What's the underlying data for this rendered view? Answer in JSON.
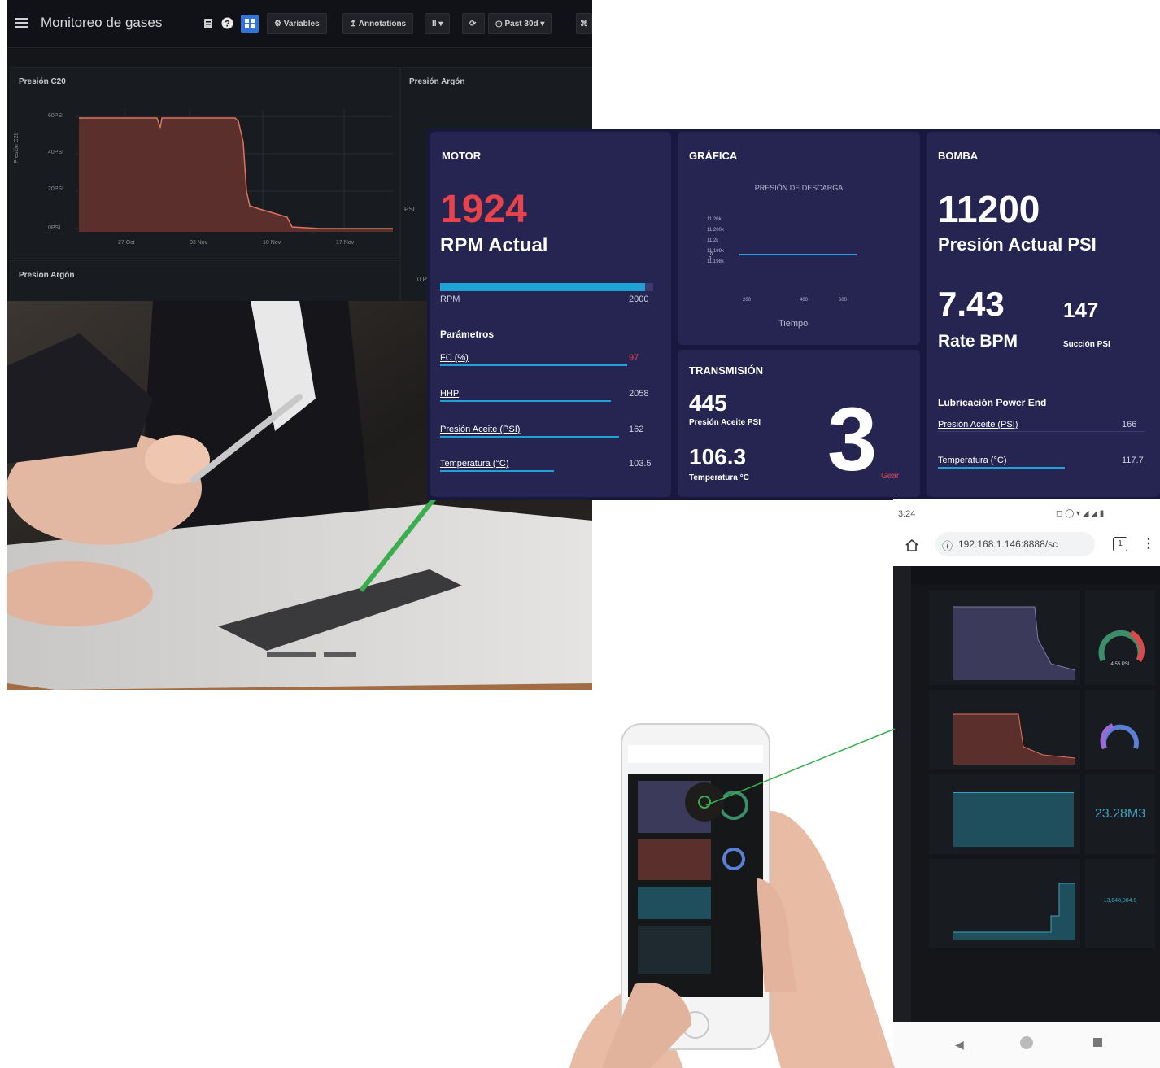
{
  "grafana": {
    "title": "Monitoreo de gases",
    "buttons": {
      "variables": "Variables",
      "annotations": "Annotations",
      "pause": "II ▾",
      "time_range": "Past 30d"
    },
    "panels": {
      "c20": {
        "title": "Presión C20",
        "ylabel": "Presión C20",
        "yticks": [
          "60PSI",
          "40PSI",
          "20PSI",
          "0PSI"
        ],
        "xticks": [
          "27 Oct",
          "03 Nov",
          "10 Nov",
          "17 Nov"
        ]
      },
      "argon": {
        "title": "Presión Argón",
        "side": "PSI"
      },
      "argon2": {
        "title": "Presion Argón",
        "side": "0 P"
      }
    },
    "colors": {
      "line": "#e0735e",
      "fill": "#5a2f2c",
      "bg": "#141619"
    }
  },
  "dashboard": {
    "motor": {
      "title": "MOTOR",
      "rpm": "1924",
      "rpm_label": "RPM Actual",
      "bar_left": "RPM",
      "bar_right": "2000",
      "rpm_fraction": 0.962,
      "params_title": "Parámetros",
      "params": [
        {
          "label": "FC (%)",
          "value": "97"
        },
        {
          "label": "HHP",
          "value": "2058"
        },
        {
          "label": "Presión Aceite (PSI)",
          "value": "162"
        },
        {
          "label": "Temperatura (°C)",
          "value": "103.5"
        }
      ]
    },
    "grafica": {
      "title": "GRÁFICA",
      "chart_title": "PRESIÓN DE DESCARGA",
      "xlabel": "Tiempo",
      "ylabel": "PSI",
      "yticks": [
        "11.20k",
        "11.200k",
        "11.2k",
        "11.199k",
        "11.198k"
      ],
      "xticks": [
        "200",
        "400",
        "600"
      ]
    },
    "transmision": {
      "title": "TRANSMISIÓN",
      "oil_pressure": "445",
      "oil_label": "Presión Aceite PSI",
      "temp": "106.3",
      "temp_label": "Temperatura °C",
      "gear": "3",
      "gear_label": "Gear"
    },
    "bomba": {
      "title": "BOMBA",
      "pressure": "11200",
      "pressure_label": "Presión Actual PSI",
      "rate": "7.43",
      "rate_label": "Rate BPM",
      "suction": "147",
      "suction_label": "Succión PSI",
      "lube_title": "Lubricación Power End",
      "lube": [
        {
          "label": "Presión Aceite (PSI)",
          "value": "166"
        },
        {
          "label": "Temperatura (°C)",
          "value": "117.7"
        }
      ]
    },
    "colors": {
      "bg": "#18173d",
      "card": "#262552",
      "accent": "#e8434a",
      "bar": "#1fa3d6"
    }
  },
  "mobile": {
    "status_time": "3:24",
    "url": "192.168.1.146:8888/sc",
    "tab_count": "1",
    "gauge1_value": "4.55 PSI",
    "big_value": "23.28M3",
    "small_value": "13,648,084.0"
  },
  "icons": [
    "menu-icon",
    "gear-icon",
    "help-icon",
    "apps-icon",
    "refresh-icon",
    "clock-icon",
    "home-icon",
    "info-icon",
    "back-icon"
  ]
}
